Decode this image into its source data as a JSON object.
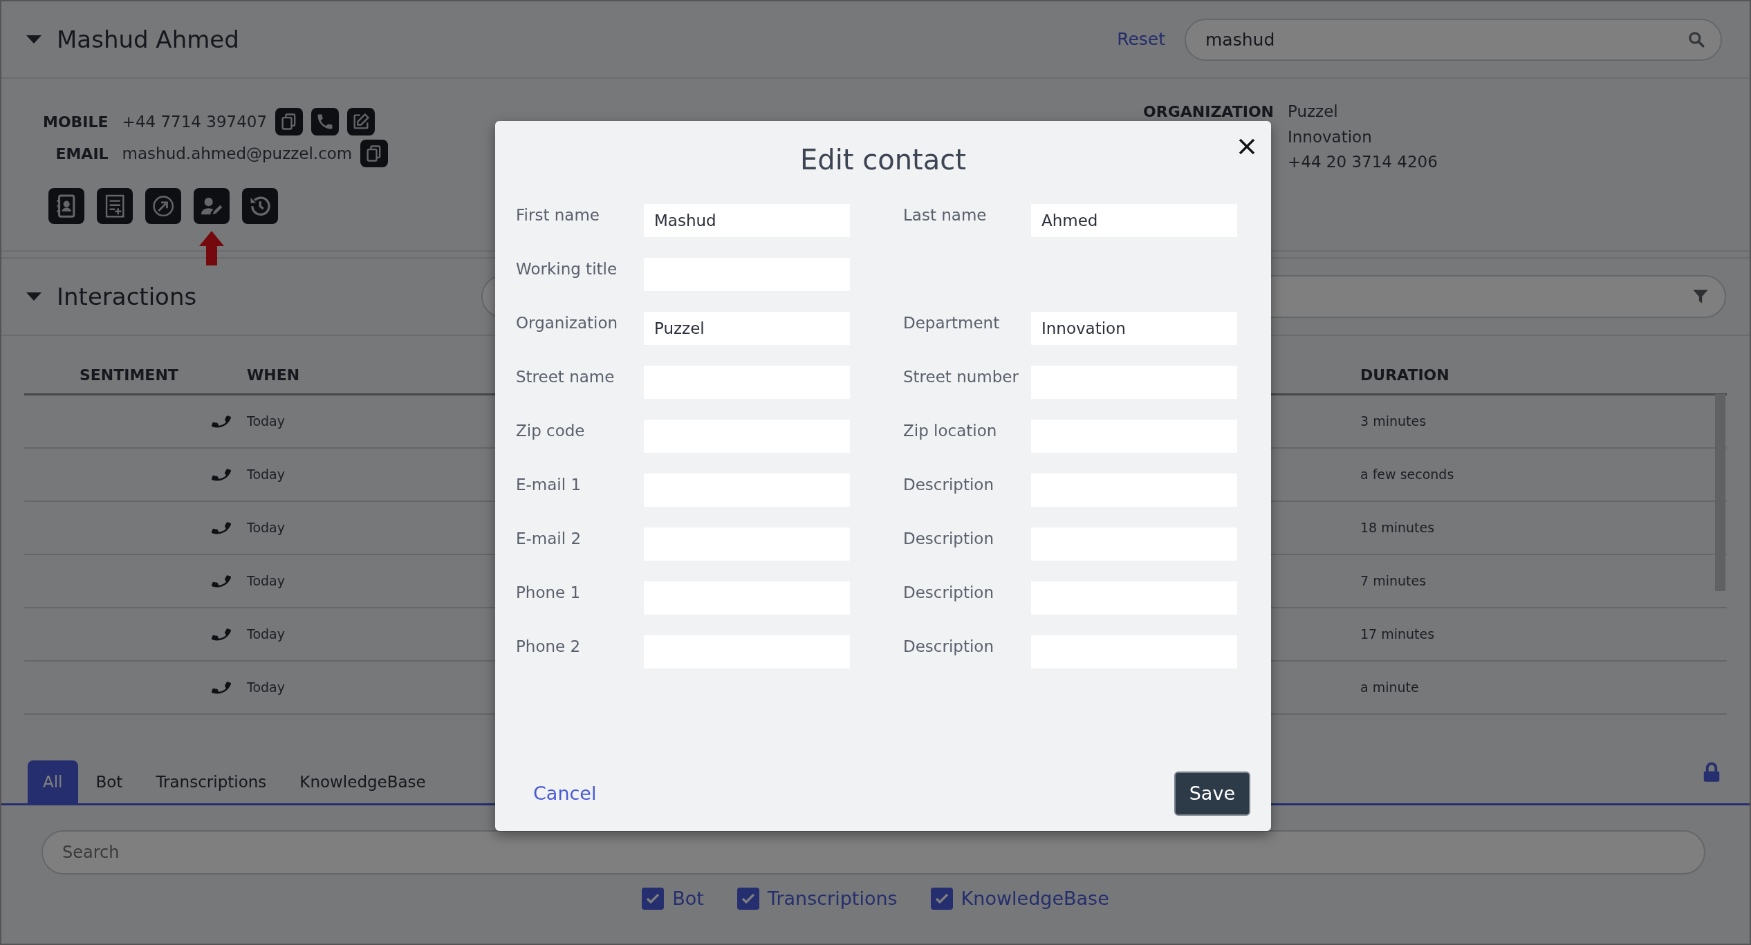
{
  "contact_header": {
    "title": "Mashud Ahmed",
    "expanded": true,
    "reset_link": "Reset",
    "search": {
      "value": "mashud"
    }
  },
  "contact_details": [
    {
      "kind": "phone",
      "label": "MOBILE",
      "value": "+44 7714 397407"
    },
    {
      "kind": "email",
      "label": "EMAIL",
      "value": "mashud.ahmed@puzzel.com"
    }
  ],
  "toolbar": [
    {
      "kind": "contacts",
      "pointed": false
    },
    {
      "kind": "note",
      "pointed": false
    },
    {
      "kind": "transfer",
      "pointed": false
    },
    {
      "kind": "edit-contact",
      "pointed": true
    },
    {
      "kind": "history",
      "pointed": false
    }
  ],
  "organization_info": [
    {
      "label": "ORGANIZATION",
      "value": "Puzzel"
    },
    {
      "value": "Innovation"
    },
    {
      "value": "+44 20 3714 4206"
    }
  ],
  "interactions": {
    "title": "Interactions",
    "expanded": true,
    "columns": [
      "SENTIMENT",
      "WHEN",
      "DURATION"
    ],
    "rows": [
      {
        "kind": "call",
        "when": "Today",
        "duration": "3 minutes"
      },
      {
        "kind": "call",
        "when": "Today",
        "duration": "a few seconds"
      },
      {
        "kind": "call",
        "when": "Today",
        "duration": "18 minutes"
      },
      {
        "kind": "call",
        "when": "Today",
        "duration": "7 minutes"
      },
      {
        "kind": "call",
        "when": "Today",
        "duration": "17 minutes"
      },
      {
        "kind": "call",
        "when": "Today",
        "duration": "a minute"
      }
    ]
  },
  "bottom_tabs": [
    {
      "label": "All",
      "selected": true
    },
    {
      "label": "Bot",
      "selected": false
    },
    {
      "label": "Transcriptions",
      "selected": false
    },
    {
      "label": "KnowledgeBase",
      "selected": false
    }
  ],
  "bottom_search": {
    "placeholder": "Search"
  },
  "source_filters": [
    {
      "label": "Bot",
      "checked": true
    },
    {
      "label": "Transcriptions",
      "checked": true
    },
    {
      "label": "KnowledgeBase",
      "checked": true
    }
  ],
  "edit_contact_dialog": {
    "title": "Edit contact",
    "rows": [
      {
        "left": {
          "label": "First name",
          "value": "Mashud"
        },
        "right": {
          "label": "Last name",
          "value": "Ahmed"
        }
      },
      {
        "left": {
          "label": "Working title"
        }
      },
      {
        "left": {
          "label": "Organization",
          "value": "Puzzel"
        },
        "right": {
          "label": "Department",
          "value": "Innovation"
        }
      },
      {
        "left": {
          "label": "Street name"
        },
        "right": {
          "label": "Street number"
        }
      },
      {
        "left": {
          "label": "Zip code"
        },
        "right": {
          "label": "Zip location"
        }
      },
      {
        "left": {
          "label": "E-mail 1"
        },
        "right": {
          "label": "Description"
        }
      },
      {
        "left": {
          "label": "E-mail 2"
        },
        "right": {
          "label": "Description"
        }
      },
      {
        "left": {
          "label": "Phone 1"
        },
        "right": {
          "label": "Description"
        }
      },
      {
        "left": {
          "label": "Phone 2"
        },
        "right": {
          "label": "Description"
        }
      }
    ],
    "cancel": "Cancel",
    "save": "Save"
  }
}
